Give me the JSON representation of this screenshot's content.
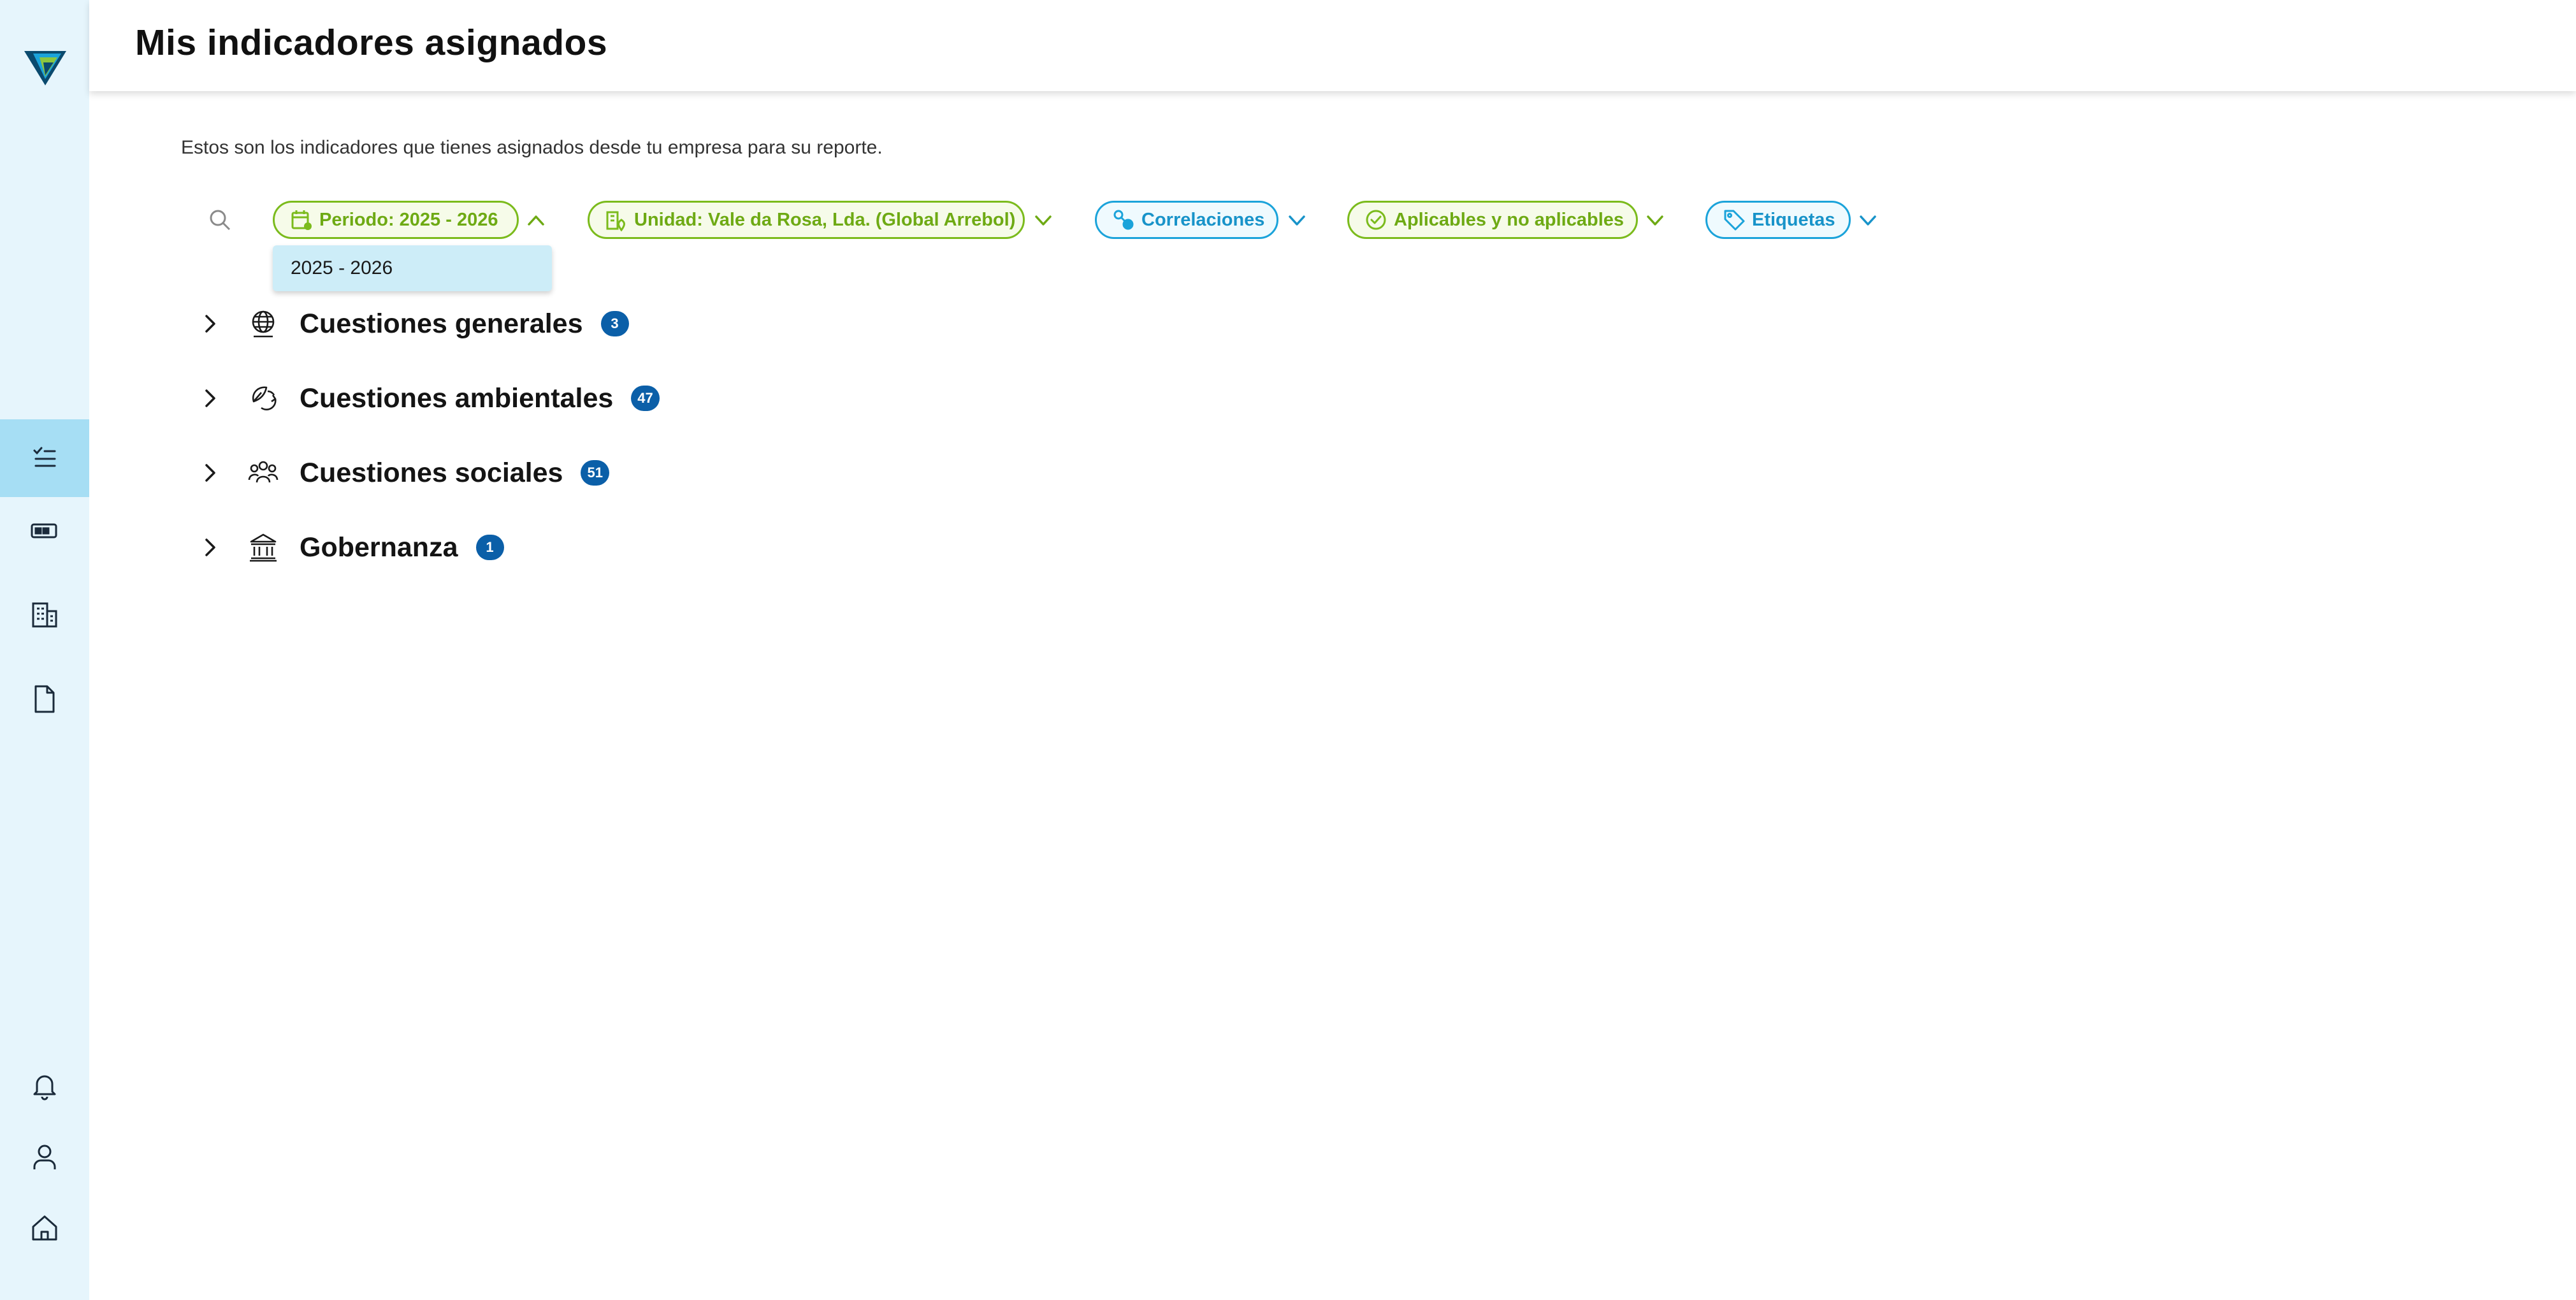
{
  "header": {
    "title": "Mis indicadores asignados"
  },
  "intro": {
    "text": "Estos son los indicadores que tienes asignados desde tu empresa para su reporte."
  },
  "filters": {
    "periodo": "Periodo: 2025 - 2026",
    "unidad": "Unidad: Vale da Rosa, Lda. (Global Arrebol)",
    "correlaciones": "Correlaciones",
    "aplicables": "Aplicables y no aplicables",
    "etiquetas": "Etiquetas"
  },
  "dropdown": {
    "selected_option": "2025 - 2026"
  },
  "sections": [
    {
      "title": "Cuestiones generales",
      "count": "3"
    },
    {
      "title": "Cuestiones ambientales",
      "count": "47"
    },
    {
      "title": "Cuestiones sociales",
      "count": "51"
    },
    {
      "title": "Gobernanza",
      "count": "1"
    }
  ],
  "icons": {
    "sidebar": [
      "logo",
      "checklist-icon",
      "battery-icon",
      "building-icon",
      "document-icon",
      "bell-icon",
      "user-icon",
      "home-icon"
    ],
    "sections": [
      "globe-icon",
      "leaf-recycle-icon",
      "people-group-icon",
      "bank-icon"
    ]
  },
  "colors": {
    "sidebar_bg": "#e6f5fc",
    "sidebar_active": "#a6def4",
    "filter_green": "#7bbb1c",
    "filter_blue": "#1ba3da",
    "badge": "#0b5fa8",
    "dropdown_bg": "#cdedf8"
  }
}
